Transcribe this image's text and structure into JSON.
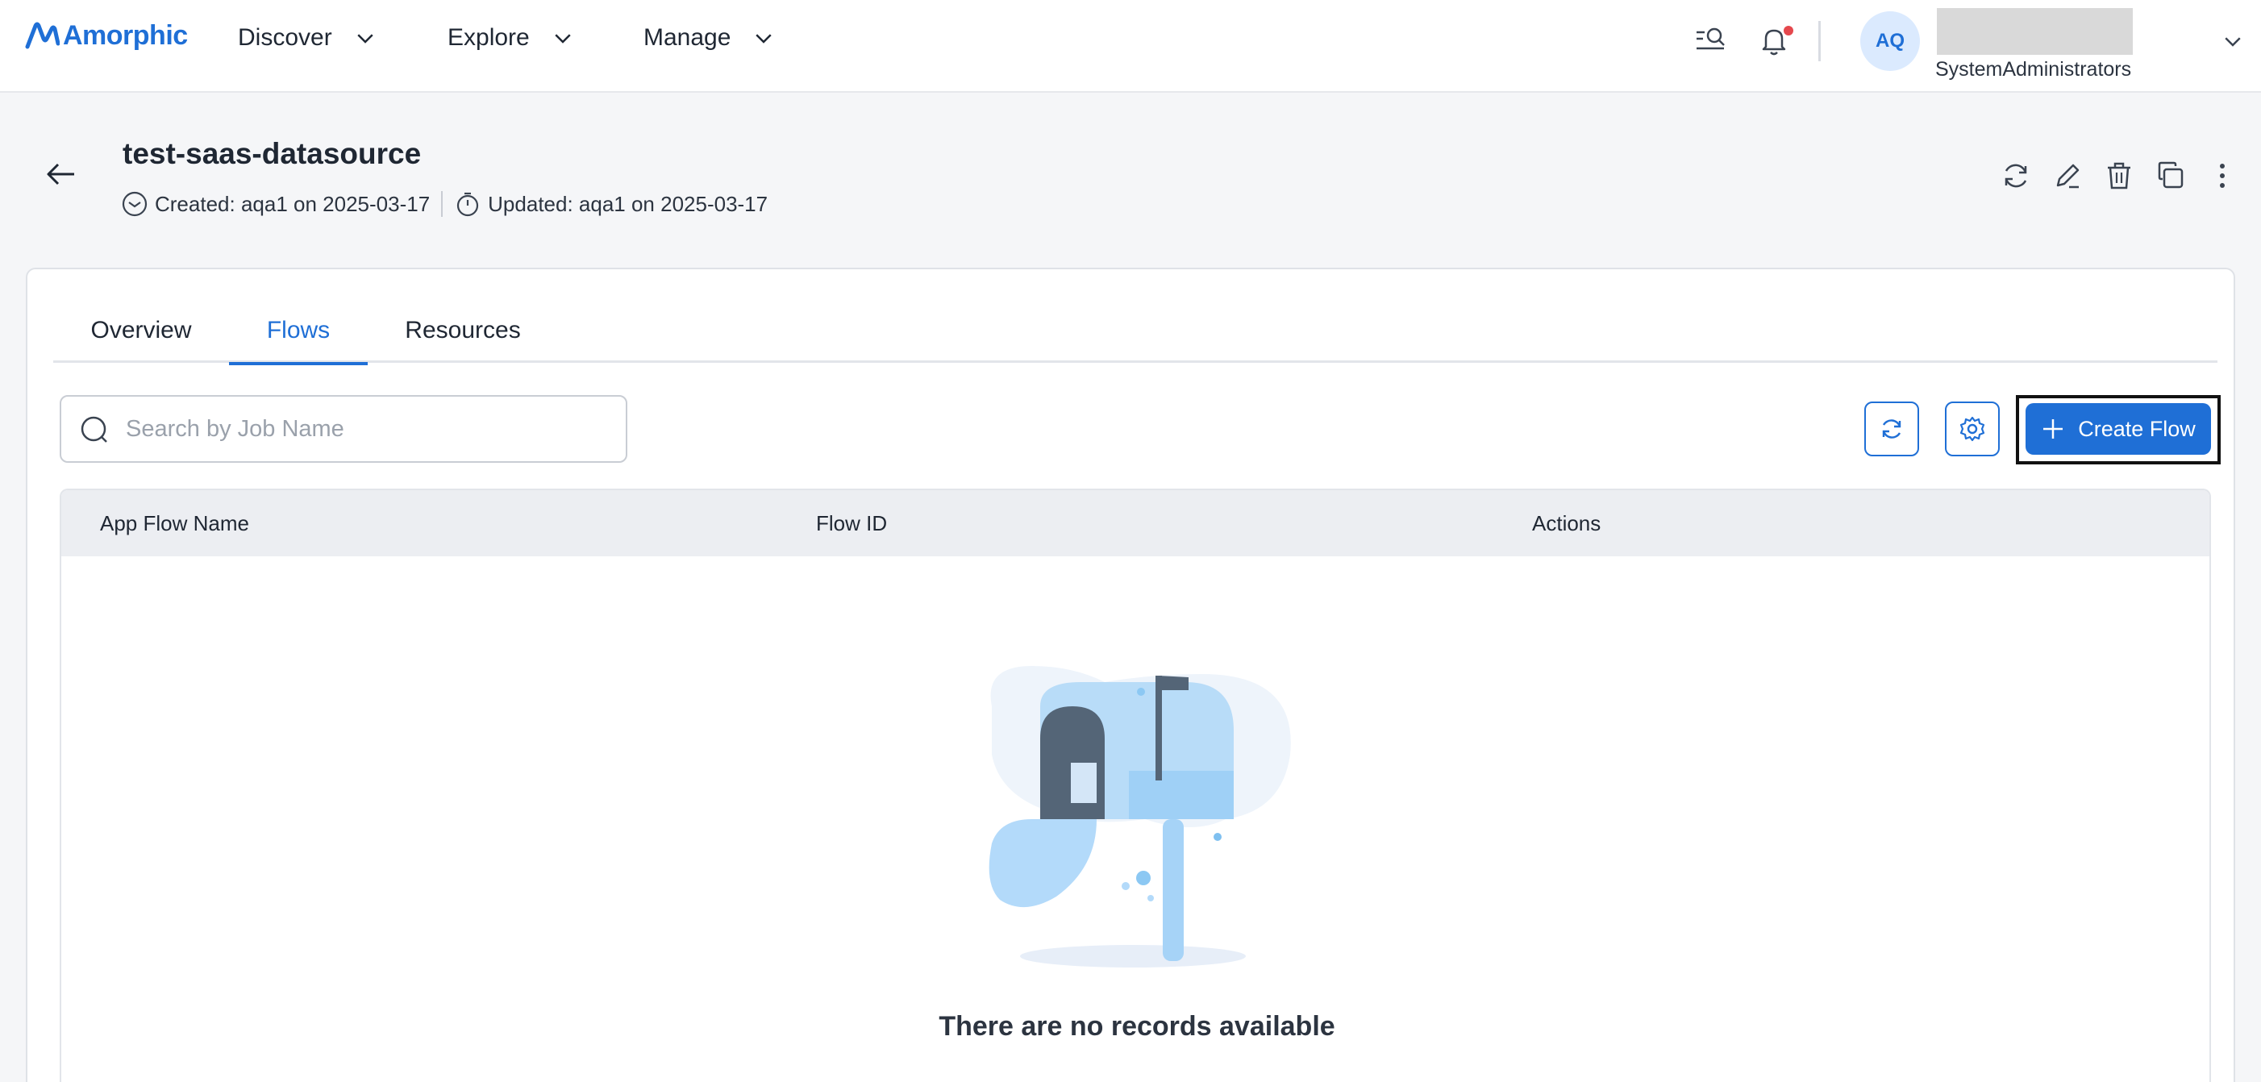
{
  "app": {
    "brand": "Amorphic",
    "nav": [
      {
        "label": "Discover"
      },
      {
        "label": "Explore"
      },
      {
        "label": "Manage"
      }
    ],
    "user": {
      "initials": "AQ",
      "role": "SystemAdministrators"
    }
  },
  "header": {
    "title": "test-saas-datasource",
    "created": "Created: aqa1 on 2025-03-17",
    "updated": "Updated: aqa1 on 2025-03-17"
  },
  "tabs": [
    {
      "label": "Overview"
    },
    {
      "label": "Flows",
      "active": true
    },
    {
      "label": "Resources"
    }
  ],
  "toolbar": {
    "search_placeholder": "Search by Job Name",
    "create_label": "Create Flow"
  },
  "table": {
    "columns": [
      "App Flow Name",
      "Flow ID",
      "Actions"
    ],
    "empty_message": "There are no records available"
  },
  "colors": {
    "accent": "#1f6fd6",
    "notification_dot": "#e5484d"
  },
  "icons": {
    "top": [
      "search-list-icon",
      "bell-icon"
    ],
    "header_actions": [
      "refresh-icon",
      "edit-icon",
      "delete-icon",
      "copy-icon",
      "more-vertical-icon"
    ],
    "toolbar": [
      "refresh-icon",
      "settings-icon",
      "plus-icon"
    ]
  }
}
